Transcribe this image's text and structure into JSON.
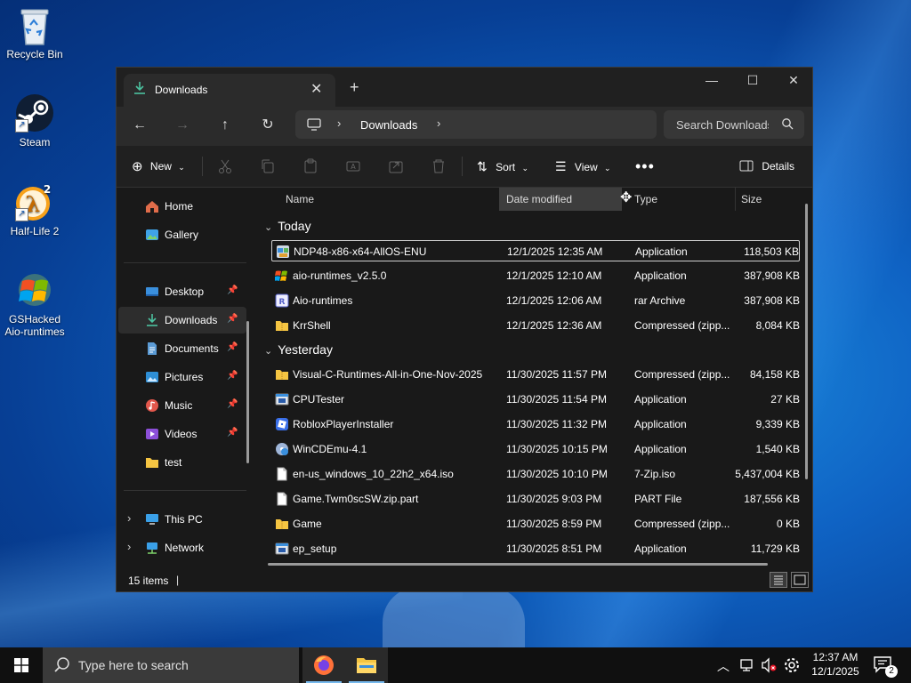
{
  "desktop": {
    "icons": [
      {
        "label": "Recycle Bin"
      },
      {
        "label": "Steam"
      },
      {
        "label": "Half-Life 2"
      },
      {
        "label": "GSHacked Aio-runtimes"
      }
    ]
  },
  "window": {
    "tab_title": "Downloads",
    "breadcrumb": "Downloads",
    "search_placeholder": "Search Downloads",
    "commands": {
      "new": "New",
      "sort": "Sort",
      "view": "View",
      "details": "Details"
    },
    "sidebar": {
      "top": [
        {
          "label": "Home"
        },
        {
          "label": "Gallery"
        }
      ],
      "pinned": [
        {
          "label": "Desktop"
        },
        {
          "label": "Downloads"
        },
        {
          "label": "Documents"
        },
        {
          "label": "Pictures"
        },
        {
          "label": "Music"
        },
        {
          "label": "Videos"
        },
        {
          "label": "test"
        }
      ],
      "bottom": [
        {
          "label": "This PC"
        },
        {
          "label": "Network"
        }
      ]
    },
    "columns": {
      "name": "Name",
      "date": "Date modified",
      "type": "Type",
      "size": "Size"
    },
    "groups": [
      {
        "label": "Today",
        "files": [
          {
            "name": "NDP48-x86-x64-AllOS-ENU",
            "date": "12/1/2025 12:35 AM",
            "type": "Application",
            "size": "118,503 KB",
            "icon": "installer-icon"
          },
          {
            "name": "aio-runtimes_v2.5.0",
            "date": "12/1/2025 12:10 AM",
            "type": "Application",
            "size": "387,908 KB",
            "icon": "app-icon"
          },
          {
            "name": "Aio-runtimes",
            "date": "12/1/2025 12:06 AM",
            "type": "rar Archive",
            "size": "387,908 KB",
            "icon": "rar-icon"
          },
          {
            "name": "KrrShell",
            "date": "12/1/2025 12:36 AM",
            "type": "Compressed (zipp...",
            "size": "8,084 KB",
            "icon": "zip-folder-icon"
          }
        ]
      },
      {
        "label": "Yesterday",
        "files": [
          {
            "name": "Visual-C-Runtimes-All-in-One-Nov-2025",
            "date": "11/30/2025 11:57 PM",
            "type": "Compressed (zipp...",
            "size": "84,158 KB",
            "icon": "zip-folder-icon"
          },
          {
            "name": "CPUTester",
            "date": "11/30/2025 11:54 PM",
            "type": "Application",
            "size": "27 KB",
            "icon": "window-app-icon"
          },
          {
            "name": "RobloxPlayerInstaller",
            "date": "11/30/2025 11:32 PM",
            "type": "Application",
            "size": "9,339 KB",
            "icon": "roblox-icon"
          },
          {
            "name": "WinCDEmu-4.1",
            "date": "11/30/2025 10:15 PM",
            "type": "Application",
            "size": "1,540 KB",
            "icon": "disc-app-icon"
          },
          {
            "name": "en-us_windows_10_22h2_x64.iso",
            "date": "11/30/2025 10:10 PM",
            "type": "7-Zip.iso",
            "size": "5,437,004 KB",
            "icon": "file-icon"
          },
          {
            "name": "Game.Twm0scSW.zip.part",
            "date": "11/30/2025 9:03 PM",
            "type": "PART File",
            "size": "187,556 KB",
            "icon": "file-icon"
          },
          {
            "name": "Game",
            "date": "11/30/2025 8:59 PM",
            "type": "Compressed (zipp...",
            "size": "0 KB",
            "icon": "zip-folder-icon"
          },
          {
            "name": "ep_setup",
            "date": "11/30/2025 8:51 PM",
            "type": "Application",
            "size": "11,729 KB",
            "icon": "window-app-icon"
          }
        ]
      }
    ],
    "status": "15 items"
  },
  "taskbar": {
    "search_placeholder": "Type here to search",
    "clock_time": "12:37 AM",
    "clock_date": "12/1/2025",
    "notification_count": "2"
  },
  "colors": {
    "accent": "#76b9ed",
    "folder": "#f5c542",
    "window_bg": "#191919"
  }
}
